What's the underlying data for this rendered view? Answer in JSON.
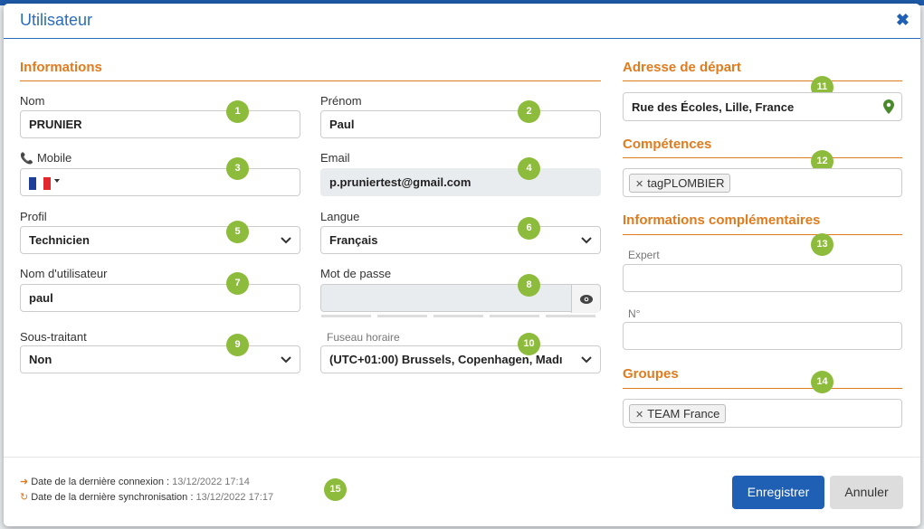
{
  "modal": {
    "title": "Utilisateur"
  },
  "sections": {
    "informations": "Informations",
    "adresse": "Adresse de départ",
    "competences": "Compétences",
    "complementaires": "Informations complémentaires",
    "groupes": "Groupes"
  },
  "fields": {
    "nom": {
      "label": "Nom",
      "value": "PRUNIER"
    },
    "prenom": {
      "label": "Prénom",
      "value": "Paul"
    },
    "mobile": {
      "label": "Mobile",
      "country": "France",
      "value": ""
    },
    "email": {
      "label": "Email",
      "value": "p.pruniertest@gmail.com"
    },
    "profil": {
      "label": "Profil",
      "value": "Technicien"
    },
    "langue": {
      "label": "Langue",
      "value": "Français"
    },
    "username": {
      "label": "Nom d'utilisateur",
      "value": "paul"
    },
    "password": {
      "label": "Mot de passe",
      "value": ""
    },
    "soustraitant": {
      "label": "Sous-traitant",
      "value": "Non"
    },
    "fuseau": {
      "label": "Fuseau horaire",
      "value": "(UTC+01:00) Brussels, Copenhagen, Madı"
    },
    "adresse": {
      "value": "Rue des Écoles, Lille, France"
    },
    "competences": {
      "tags": [
        "tagPLOMBIER"
      ]
    },
    "expert": {
      "label": "Expert",
      "value": ""
    },
    "numero": {
      "label": "N°",
      "value": ""
    },
    "groupes": {
      "tags": [
        "TEAM France"
      ]
    }
  },
  "badges": [
    "1",
    "2",
    "3",
    "4",
    "5",
    "6",
    "7",
    "8",
    "9",
    "10",
    "11",
    "12",
    "13",
    "14",
    "15"
  ],
  "footer": {
    "last_login_label": "Date de la dernière connexion :",
    "last_login_value": "13/12/2022 17:14",
    "last_sync_label": "Date de la dernière synchronisation :",
    "last_sync_value": "13/12/2022 17:17"
  },
  "buttons": {
    "save": "Enregistrer",
    "cancel": "Annuler"
  },
  "icons": {
    "close": "close-icon",
    "phone": "phone-icon",
    "eye": "eye-icon",
    "pin": "map-pin-icon",
    "login": "sign-in-icon",
    "sync": "sync-icon",
    "chevron": "chevron-down-icon"
  },
  "colors": {
    "primary": "#1f5fb4",
    "accent": "#e07b1e",
    "badge": "#8dbb3c",
    "pin": "#4a8a2a"
  }
}
